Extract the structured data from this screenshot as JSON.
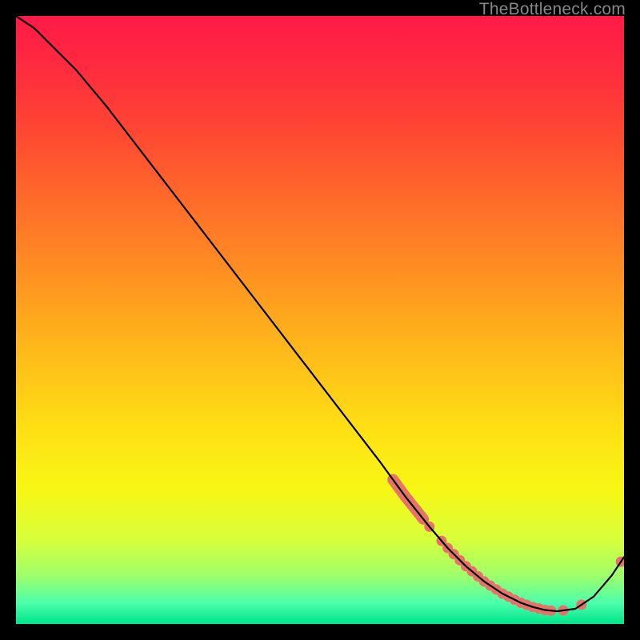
{
  "watermark": "TheBottleneck.com",
  "chart_data": {
    "type": "line",
    "title": "",
    "xlabel": "",
    "ylabel": "",
    "xlim": [
      0,
      100
    ],
    "ylim": [
      0,
      100
    ],
    "curve": {
      "x": [
        0,
        3,
        6,
        10,
        15,
        20,
        25,
        30,
        35,
        40,
        45,
        50,
        55,
        60,
        64,
        68,
        71,
        74,
        77,
        80,
        83,
        85,
        87,
        89,
        92,
        95,
        98,
        100
      ],
      "y": [
        100,
        98,
        95,
        91,
        85,
        78.5,
        72,
        65.5,
        59,
        52.5,
        46,
        39.5,
        33,
        26.5,
        21,
        16,
        12.5,
        9.5,
        7,
        5,
        3.5,
        2.8,
        2.3,
        2.1,
        2.5,
        4.5,
        8,
        11
      ]
    },
    "salmon_segment_start_x": 62,
    "salmon_segment_end_x": 67,
    "salmon_dots_x": [
      68,
      70,
      71,
      72,
      73,
      74,
      75,
      76,
      77,
      78,
      79,
      80,
      81,
      82,
      83,
      84,
      85,
      86,
      87,
      88,
      90,
      93,
      99.5
    ],
    "gradient_stops": [
      {
        "offset": 0.0,
        "color": "#ff1a47"
      },
      {
        "offset": 0.08,
        "color": "#ff2a3f"
      },
      {
        "offset": 0.18,
        "color": "#ff4433"
      },
      {
        "offset": 0.3,
        "color": "#ff6a2a"
      },
      {
        "offset": 0.42,
        "color": "#ff8f22"
      },
      {
        "offset": 0.55,
        "color": "#ffb91a"
      },
      {
        "offset": 0.68,
        "color": "#ffe014"
      },
      {
        "offset": 0.78,
        "color": "#f7f714"
      },
      {
        "offset": 0.86,
        "color": "#d8ff3a"
      },
      {
        "offset": 0.92,
        "color": "#9fff6a"
      },
      {
        "offset": 0.965,
        "color": "#4dffac"
      },
      {
        "offset": 1.0,
        "color": "#00e58b"
      }
    ],
    "salmon_color": "#e57368",
    "curve_color": "#000000"
  }
}
